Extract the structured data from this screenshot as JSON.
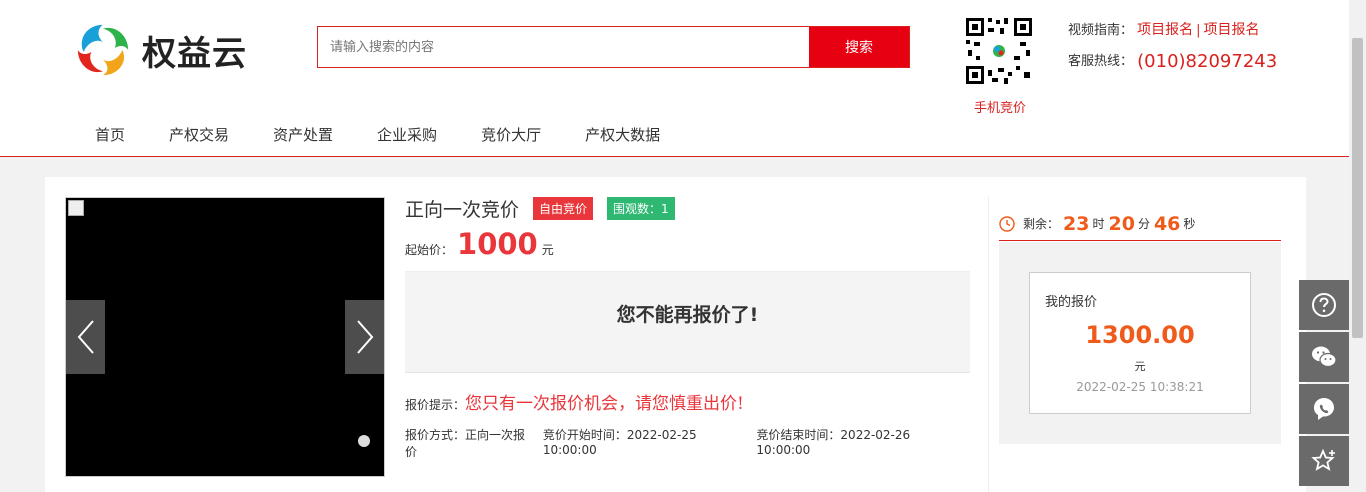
{
  "brand": {
    "name": "权益云"
  },
  "search": {
    "placeholder": "请输入搜索的内容",
    "button_label": "搜索"
  },
  "qr": {
    "label": "手机竞价"
  },
  "contact": {
    "guide_label": "视频指南：",
    "guide_link1": "项目报名",
    "guide_sep": "|",
    "guide_link2": "项目报名",
    "hotline_label": "客服热线：",
    "hotline": "(010)82097243"
  },
  "nav": {
    "items": [
      "首页",
      "产权交易",
      "资产处置",
      "企业采购",
      "竞价大厅",
      "产权大数据"
    ]
  },
  "auction": {
    "title": "正向一次竞价",
    "badge_type": "自由竞价",
    "watch_label": "围观数：",
    "watch_count": "1",
    "start_price_label": "起始价：",
    "start_price": "1000",
    "start_price_unit": "元",
    "notice": "您不能再报价了!",
    "hint_label": "报价提示：",
    "hint_text": "您只有一次报价机会，请您慎重出价!",
    "method_label": "报价方式：正向一次报价",
    "start_time_label": "竞价开始时间：2022-02-25 10:00:00",
    "end_time_label": "竞价结束时间：2022-02-26 10:00:00"
  },
  "countdown": {
    "label": "剩余：",
    "hours": "23",
    "hours_unit": "时",
    "minutes": "20",
    "minutes_unit": "分",
    "seconds": "46",
    "seconds_unit": "秒"
  },
  "my_bid": {
    "label": "我的报价",
    "price": "1300.00",
    "unit": "元",
    "time": "2022-02-25 10:38:21"
  },
  "side_tools": [
    "help-icon",
    "wechat-icon",
    "phone-icon",
    "favorite-icon"
  ],
  "colors": {
    "accent": "#e60012",
    "price": "#e9363a",
    "countdown": "#f05a1a",
    "badge_green": "#2eb872"
  }
}
